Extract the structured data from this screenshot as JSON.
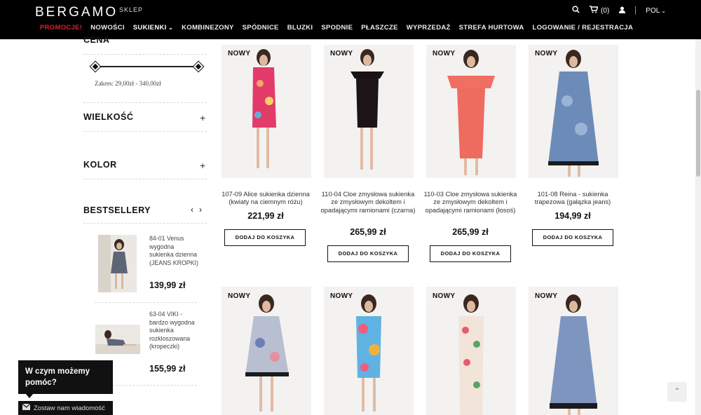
{
  "header": {
    "logo": "BERGAMO",
    "logo_sub": "SKLEP",
    "cart_label": "(0)",
    "language": "POL",
    "nav": [
      {
        "label": "PROMOCJE!"
      },
      {
        "label": "NOWOŚCI"
      },
      {
        "label": "SUKIENKI"
      },
      {
        "label": "KOMBINEZONY"
      },
      {
        "label": "SPÓDNICE"
      },
      {
        "label": "BLUZKI"
      },
      {
        "label": "SPODNIE"
      },
      {
        "label": "PŁASZCZE"
      },
      {
        "label": "WYPRZEDAŻ"
      },
      {
        "label": "STREFA HURTOWA"
      },
      {
        "label": "LOGOWANIE / REJESTRACJA"
      }
    ]
  },
  "sidebar": {
    "price_title": "CENA",
    "range_text": "Zakres: 29,00zł - 340,00zł",
    "size_title": "WIELKOŚĆ",
    "color_title": "KOLOR",
    "bestsellers_title": "BESTSELLERY",
    "bestsellers": [
      {
        "name": "84-01 Venus wygodna sukienka dzienna (JEANS KROPKI)",
        "price": "139,99 zł"
      },
      {
        "name": "63-04 VIKI - bardzo wygodna sukienka rozkloszowana (kropeczki)",
        "price": "155,99 zł"
      }
    ]
  },
  "products": [
    {
      "badge": "NOWY",
      "name": "107-09 Alice sukienka dzienna (kwiaty na ciemnym różu)",
      "price": "221,99 zł",
      "button": "DODAJ DO KOSZYKA"
    },
    {
      "badge": "NOWY",
      "name": "110-04 Cloe zmysłowa sukienka ze zmysłowym dekoltem i opadającymi ramionami (czarna)",
      "price": "265,99 zł",
      "button": "DODAJ DO KOSZYKA"
    },
    {
      "badge": "NOWY",
      "name": "110-03 Cloe zmysłowa sukienka ze zmysłowym dekoltem i opadającymi ramionami (łosoś)",
      "price": "265,99 zł",
      "button": "DODAJ DO KOSZYKA"
    },
    {
      "badge": "NOWY",
      "name": "101-08 Reina - sukienka trapezowa (gałązka jeans)",
      "price": "194,99 zł",
      "button": "DODAJ DO KOSZYKA"
    },
    {
      "badge": "NOWY"
    },
    {
      "badge": "NOWY"
    },
    {
      "badge": "NOWY"
    },
    {
      "badge": "NOWY"
    }
  ],
  "chat": {
    "title": "W czym możemy pomóc?",
    "leave_message": "Zostaw nam wiadomość"
  },
  "colors": {
    "promo": "#e41b2c",
    "header_bg": "#000000"
  }
}
